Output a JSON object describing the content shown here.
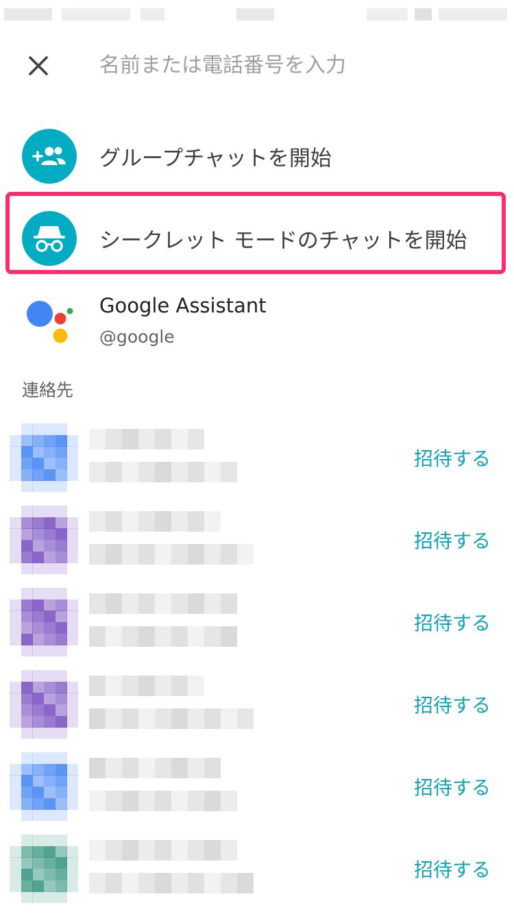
{
  "search": {
    "placeholder": "名前または電話番号を入力",
    "value": ""
  },
  "actions": [
    {
      "label": "グループチャットを開始",
      "icon": "group-add-icon"
    },
    {
      "label": "シークレット モードのチャットを開始",
      "icon": "incognito-icon"
    }
  ],
  "assistant": {
    "name": "Google Assistant",
    "handle": "@google",
    "icon": "google-assistant-icon"
  },
  "contacts": {
    "header": "連絡先",
    "items": [
      {
        "invite_label": "招待する",
        "avatar_color": "#4a8af4"
      },
      {
        "invite_label": "招待する",
        "avatar_color": "#7e57c2"
      },
      {
        "invite_label": "招待する",
        "avatar_color": "#7e57c2"
      },
      {
        "invite_label": "招待する",
        "avatar_color": "#7e57c2"
      },
      {
        "invite_label": "招待する",
        "avatar_color": "#4a8af4"
      },
      {
        "invite_label": "招待する",
        "avatar_color": "#3f9a86"
      }
    ]
  },
  "colors": {
    "accent": "#00acc1",
    "highlight": "#ff2d6f",
    "invite_text": "#12a4b6"
  }
}
